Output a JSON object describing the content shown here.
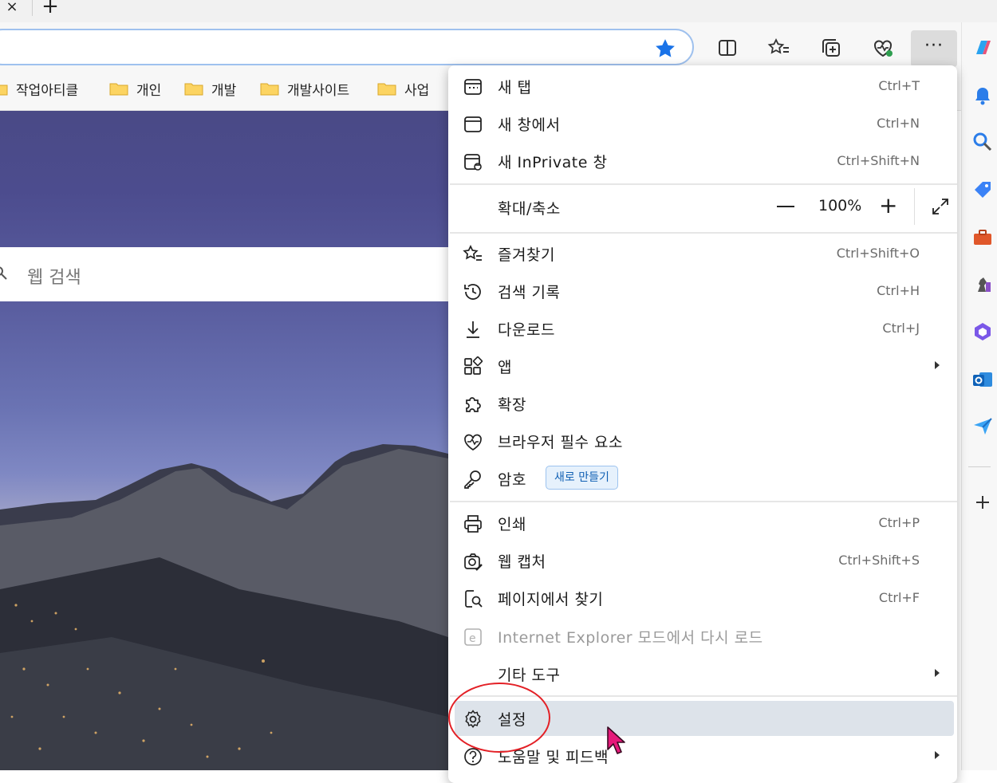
{
  "tabs": {
    "close_glyph": "×",
    "new_tab_glyph": "+"
  },
  "favorites": [
    {
      "label": "작업아티클"
    },
    {
      "label": "개인"
    },
    {
      "label": "개발"
    },
    {
      "label": "개발사이트"
    },
    {
      "label": "사업"
    }
  ],
  "page": {
    "search_placeholder": "웹 검색"
  },
  "toolbar": {
    "more_glyph": "···"
  },
  "menu": {
    "new_tab": {
      "label": "새 탭",
      "shortcut": "Ctrl+T"
    },
    "new_window": {
      "label": "새 창에서",
      "shortcut": "Ctrl+N"
    },
    "inprivate": {
      "label": "새 InPrivate 창",
      "shortcut": "Ctrl+Shift+N"
    },
    "zoom": {
      "label": "확대/축소",
      "value": "100%",
      "plus": "+"
    },
    "favorites": {
      "label": "즐겨찾기",
      "shortcut": "Ctrl+Shift+O"
    },
    "history": {
      "label": "검색 기록",
      "shortcut": "Ctrl+H"
    },
    "downloads": {
      "label": "다운로드",
      "shortcut": "Ctrl+J"
    },
    "apps": {
      "label": "앱"
    },
    "extensions": {
      "label": "확장"
    },
    "essentials": {
      "label": "브라우저 필수 요소"
    },
    "passwords": {
      "label": "암호",
      "badge": "새로 만들기"
    },
    "print": {
      "label": "인쇄",
      "shortcut": "Ctrl+P"
    },
    "capture": {
      "label": "웹 캡처",
      "shortcut": "Ctrl+Shift+S"
    },
    "find": {
      "label": "페이지에서 찾기",
      "shortcut": "Ctrl+F"
    },
    "ie_mode": {
      "label": "Internet Explorer 모드에서 다시 로드"
    },
    "more_tools": {
      "label": "기타 도구"
    },
    "settings": {
      "label": "설정"
    },
    "help": {
      "label": "도움말 및 피드백"
    }
  },
  "colors": {
    "accent": "#1a73e8",
    "selected": "#dde3ea",
    "annotation": "#e32026"
  }
}
